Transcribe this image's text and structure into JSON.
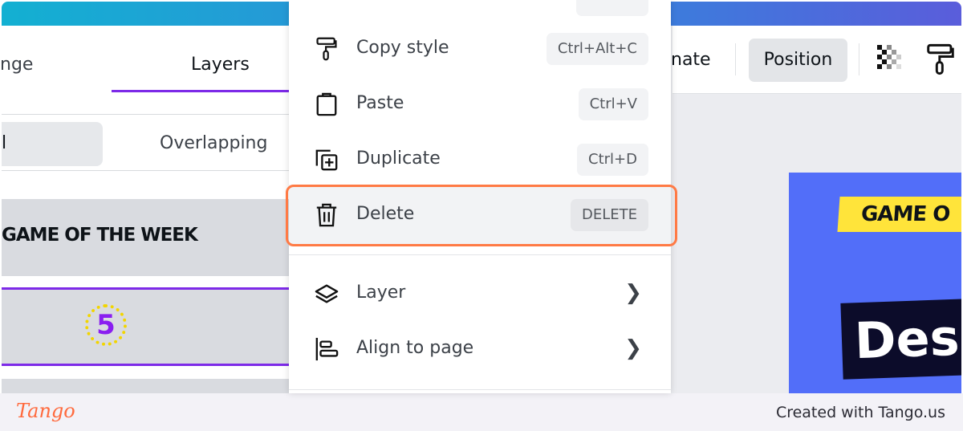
{
  "left_panel": {
    "tabs": [
      {
        "label": "nge"
      },
      {
        "label": "Layers"
      }
    ],
    "filters": [
      {
        "label": "l"
      },
      {
        "label": "Overlapping"
      }
    ],
    "layers": [
      {
        "label": "GAME OF THE WEEK"
      },
      {
        "label": "5"
      }
    ]
  },
  "context_menu": {
    "items": [
      {
        "label": "Copy style",
        "shortcut": "Ctrl+Alt+C",
        "icon": "paint-roller-icon"
      },
      {
        "label": "Paste",
        "shortcut": "Ctrl+V",
        "icon": "clipboard-icon"
      },
      {
        "label": "Duplicate",
        "shortcut": "Ctrl+D",
        "icon": "duplicate-icon"
      },
      {
        "label": "Delete",
        "shortcut": "DELETE",
        "icon": "trash-icon"
      },
      {
        "label": "Layer",
        "icon": "layers-icon"
      },
      {
        "label": "Align to page",
        "icon": "align-icon"
      }
    ]
  },
  "toolbar": {
    "animate": "nate",
    "position": "Position"
  },
  "canvas": {
    "banner": "GAME O",
    "title": "Des"
  },
  "footer": {
    "logo": "Tango",
    "credit": "Created with Tango.us"
  },
  "colors": {
    "accent": "#7d2ae8",
    "highlight": "#ff7a45",
    "design": "#526ef9"
  }
}
